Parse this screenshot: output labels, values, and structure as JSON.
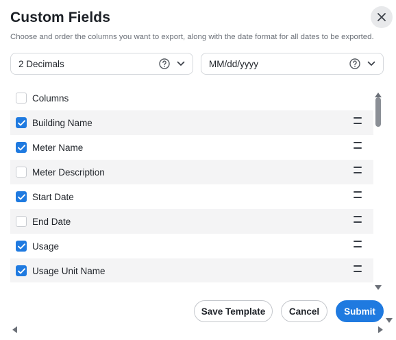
{
  "header": {
    "title": "Custom Fields",
    "subtitle": "Choose and order the columns you want to export, along with the date format for all dates to be exported."
  },
  "decimal_select": {
    "value": "2 Decimals"
  },
  "date_select": {
    "value": "MM/dd/yyyy"
  },
  "columns": {
    "header_label": "Columns",
    "items": [
      {
        "label": "Building Name",
        "checked": true
      },
      {
        "label": "Meter Name",
        "checked": true
      },
      {
        "label": "Meter Description",
        "checked": false
      },
      {
        "label": "Start Date",
        "checked": true
      },
      {
        "label": "End Date",
        "checked": false
      },
      {
        "label": "Usage",
        "checked": true
      },
      {
        "label": "Usage Unit Name",
        "checked": true
      }
    ]
  },
  "footer": {
    "save_template_label": "Save Template",
    "cancel_label": "Cancel",
    "submit_label": "Submit"
  },
  "icons": {
    "close": "close-icon",
    "help": "help-circle-icon",
    "chevron": "chevron-down-icon",
    "check": "check-icon",
    "drag": "drag-handle-icon"
  },
  "colors": {
    "accent": "#1f7ae0",
    "row_alt": "#f4f4f5",
    "border": "#d5d8dc"
  }
}
